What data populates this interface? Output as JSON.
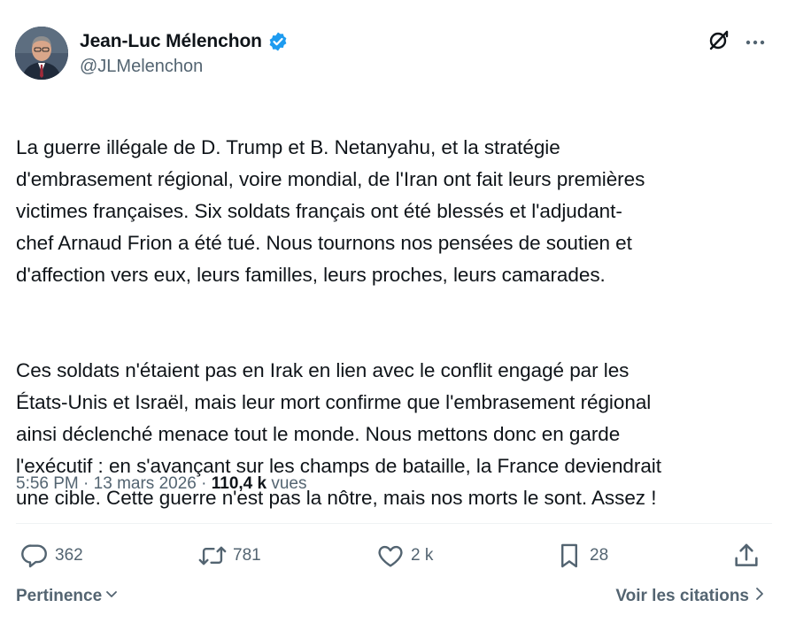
{
  "author": {
    "display_name": "Jean-Luc Mélenchon",
    "handle": "@JLMelenchon",
    "verified": true,
    "verified_color": "#1d9bf0"
  },
  "tweet": {
    "paragraphs": [
      "La guerre illégale de D. Trump et B. Netanyahu, et la stratégie\nd'embrasement régional, voire mondial, de l'Iran ont fait leurs premières\nvictimes françaises. Six soldats français ont été blessés et l'adjudant-\nchef Arnaud Frion a été tué. Nous tournons nos pensées de soutien et\nd'affection vers eux, leurs familles, leurs proches, leurs camarades.",
      "Ces soldats n'étaient pas en Irak en lien avec le conflit engagé par les\nÉtats-Unis et Israël, mais leur mort confirme que l'embrasement régional\nainsi déclenché menace tout le monde. Nous mettons donc en garde\nl'exécutif : en s'avançant sur les champs de bataille, la France deviendrait\nune cible. Cette guerre n'est pas la nôtre, mais nos morts le sont. Assez !"
    ]
  },
  "meta": {
    "time": "5:56 PM",
    "separator": " · ",
    "date": "13 mars 2026",
    "views_count": "110,4 k",
    "views_label": " vues"
  },
  "actions": {
    "replies": "362",
    "reposts": "781",
    "likes": "2 k",
    "bookmarks": "28"
  },
  "footer": {
    "sort_label": "Pertinence",
    "quotes_label": "Voir les citations"
  },
  "colors": {
    "text_primary": "#0f1419",
    "text_secondary": "#536471",
    "divider": "#eff3f4"
  },
  "icons": [
    "grok-icon",
    "more-icon",
    "reply-icon",
    "repost-icon",
    "like-icon",
    "bookmark-icon",
    "share-icon",
    "chevron-down-icon",
    "chevron-right-icon",
    "verified-badge-icon"
  ]
}
